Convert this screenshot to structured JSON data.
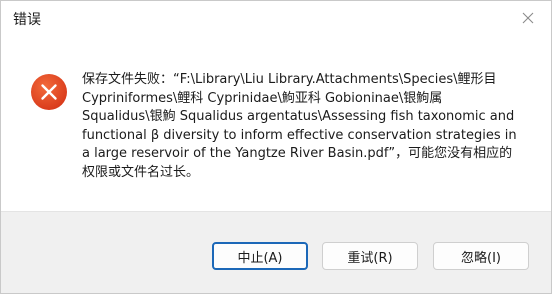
{
  "window": {
    "title": "错误",
    "close_icon": "close-icon"
  },
  "error": {
    "icon": "error-x-icon",
    "icon_color": "#e24a1f",
    "message": "保存文件失败：“F:\\Library\\Liu Library.Attachments\\Species\\鲤形目Cypriniformes\\鲤科 Cyprinidae\\鮈亚科 Gobioninae\\银鮈属Squalidus\\银鮈 Squalidus argentatus\\Assessing fish taxonomic and functional β diversity to inform effective conservation strategies in a large reservoir of the Yangtze River Basin.pdf”，可能您没有相应的权限或文件名过长。"
  },
  "buttons": {
    "abort": "中止(A)",
    "retry": "重试(R)",
    "ignore": "忽略(I)"
  },
  "colors": {
    "accent": "#1c68b8",
    "footer_bg": "#f0f0f0"
  }
}
